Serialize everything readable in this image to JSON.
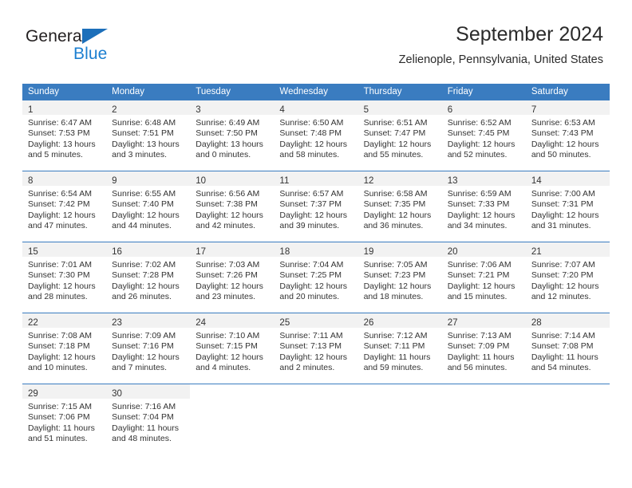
{
  "logo": {
    "primary_text": "General",
    "secondary_text": "Blue",
    "triangle_color": "#1c6fba",
    "primary_color": "#231f20",
    "secondary_color": "#1c7fd0"
  },
  "header": {
    "title": "September 2024",
    "subtitle": "Zelienople, Pennsylvania, United States"
  },
  "theme": {
    "header_bg": "#3a7cc0",
    "header_text": "#ffffff",
    "daynum_bg": "#f2f2f2",
    "body_text": "#333333"
  },
  "calendar": {
    "weekday_headers": [
      "Sunday",
      "Monday",
      "Tuesday",
      "Wednesday",
      "Thursday",
      "Friday",
      "Saturday"
    ],
    "weeks": [
      [
        {
          "day": "1",
          "sunrise": "Sunrise: 6:47 AM",
          "sunset": "Sunset: 7:53 PM",
          "daylight_1": "Daylight: 13 hours",
          "daylight_2": "and 5 minutes."
        },
        {
          "day": "2",
          "sunrise": "Sunrise: 6:48 AM",
          "sunset": "Sunset: 7:51 PM",
          "daylight_1": "Daylight: 13 hours",
          "daylight_2": "and 3 minutes."
        },
        {
          "day": "3",
          "sunrise": "Sunrise: 6:49 AM",
          "sunset": "Sunset: 7:50 PM",
          "daylight_1": "Daylight: 13 hours",
          "daylight_2": "and 0 minutes."
        },
        {
          "day": "4",
          "sunrise": "Sunrise: 6:50 AM",
          "sunset": "Sunset: 7:48 PM",
          "daylight_1": "Daylight: 12 hours",
          "daylight_2": "and 58 minutes."
        },
        {
          "day": "5",
          "sunrise": "Sunrise: 6:51 AM",
          "sunset": "Sunset: 7:47 PM",
          "daylight_1": "Daylight: 12 hours",
          "daylight_2": "and 55 minutes."
        },
        {
          "day": "6",
          "sunrise": "Sunrise: 6:52 AM",
          "sunset": "Sunset: 7:45 PM",
          "daylight_1": "Daylight: 12 hours",
          "daylight_2": "and 52 minutes."
        },
        {
          "day": "7",
          "sunrise": "Sunrise: 6:53 AM",
          "sunset": "Sunset: 7:43 PM",
          "daylight_1": "Daylight: 12 hours",
          "daylight_2": "and 50 minutes."
        }
      ],
      [
        {
          "day": "8",
          "sunrise": "Sunrise: 6:54 AM",
          "sunset": "Sunset: 7:42 PM",
          "daylight_1": "Daylight: 12 hours",
          "daylight_2": "and 47 minutes."
        },
        {
          "day": "9",
          "sunrise": "Sunrise: 6:55 AM",
          "sunset": "Sunset: 7:40 PM",
          "daylight_1": "Daylight: 12 hours",
          "daylight_2": "and 44 minutes."
        },
        {
          "day": "10",
          "sunrise": "Sunrise: 6:56 AM",
          "sunset": "Sunset: 7:38 PM",
          "daylight_1": "Daylight: 12 hours",
          "daylight_2": "and 42 minutes."
        },
        {
          "day": "11",
          "sunrise": "Sunrise: 6:57 AM",
          "sunset": "Sunset: 7:37 PM",
          "daylight_1": "Daylight: 12 hours",
          "daylight_2": "and 39 minutes."
        },
        {
          "day": "12",
          "sunrise": "Sunrise: 6:58 AM",
          "sunset": "Sunset: 7:35 PM",
          "daylight_1": "Daylight: 12 hours",
          "daylight_2": "and 36 minutes."
        },
        {
          "day": "13",
          "sunrise": "Sunrise: 6:59 AM",
          "sunset": "Sunset: 7:33 PM",
          "daylight_1": "Daylight: 12 hours",
          "daylight_2": "and 34 minutes."
        },
        {
          "day": "14",
          "sunrise": "Sunrise: 7:00 AM",
          "sunset": "Sunset: 7:31 PM",
          "daylight_1": "Daylight: 12 hours",
          "daylight_2": "and 31 minutes."
        }
      ],
      [
        {
          "day": "15",
          "sunrise": "Sunrise: 7:01 AM",
          "sunset": "Sunset: 7:30 PM",
          "daylight_1": "Daylight: 12 hours",
          "daylight_2": "and 28 minutes."
        },
        {
          "day": "16",
          "sunrise": "Sunrise: 7:02 AM",
          "sunset": "Sunset: 7:28 PM",
          "daylight_1": "Daylight: 12 hours",
          "daylight_2": "and 26 minutes."
        },
        {
          "day": "17",
          "sunrise": "Sunrise: 7:03 AM",
          "sunset": "Sunset: 7:26 PM",
          "daylight_1": "Daylight: 12 hours",
          "daylight_2": "and 23 minutes."
        },
        {
          "day": "18",
          "sunrise": "Sunrise: 7:04 AM",
          "sunset": "Sunset: 7:25 PM",
          "daylight_1": "Daylight: 12 hours",
          "daylight_2": "and 20 minutes."
        },
        {
          "day": "19",
          "sunrise": "Sunrise: 7:05 AM",
          "sunset": "Sunset: 7:23 PM",
          "daylight_1": "Daylight: 12 hours",
          "daylight_2": "and 18 minutes."
        },
        {
          "day": "20",
          "sunrise": "Sunrise: 7:06 AM",
          "sunset": "Sunset: 7:21 PM",
          "daylight_1": "Daylight: 12 hours",
          "daylight_2": "and 15 minutes."
        },
        {
          "day": "21",
          "sunrise": "Sunrise: 7:07 AM",
          "sunset": "Sunset: 7:20 PM",
          "daylight_1": "Daylight: 12 hours",
          "daylight_2": "and 12 minutes."
        }
      ],
      [
        {
          "day": "22",
          "sunrise": "Sunrise: 7:08 AM",
          "sunset": "Sunset: 7:18 PM",
          "daylight_1": "Daylight: 12 hours",
          "daylight_2": "and 10 minutes."
        },
        {
          "day": "23",
          "sunrise": "Sunrise: 7:09 AM",
          "sunset": "Sunset: 7:16 PM",
          "daylight_1": "Daylight: 12 hours",
          "daylight_2": "and 7 minutes."
        },
        {
          "day": "24",
          "sunrise": "Sunrise: 7:10 AM",
          "sunset": "Sunset: 7:15 PM",
          "daylight_1": "Daylight: 12 hours",
          "daylight_2": "and 4 minutes."
        },
        {
          "day": "25",
          "sunrise": "Sunrise: 7:11 AM",
          "sunset": "Sunset: 7:13 PM",
          "daylight_1": "Daylight: 12 hours",
          "daylight_2": "and 2 minutes."
        },
        {
          "day": "26",
          "sunrise": "Sunrise: 7:12 AM",
          "sunset": "Sunset: 7:11 PM",
          "daylight_1": "Daylight: 11 hours",
          "daylight_2": "and 59 minutes."
        },
        {
          "day": "27",
          "sunrise": "Sunrise: 7:13 AM",
          "sunset": "Sunset: 7:09 PM",
          "daylight_1": "Daylight: 11 hours",
          "daylight_2": "and 56 minutes."
        },
        {
          "day": "28",
          "sunrise": "Sunrise: 7:14 AM",
          "sunset": "Sunset: 7:08 PM",
          "daylight_1": "Daylight: 11 hours",
          "daylight_2": "and 54 minutes."
        }
      ],
      [
        {
          "day": "29",
          "sunrise": "Sunrise: 7:15 AM",
          "sunset": "Sunset: 7:06 PM",
          "daylight_1": "Daylight: 11 hours",
          "daylight_2": "and 51 minutes."
        },
        {
          "day": "30",
          "sunrise": "Sunrise: 7:16 AM",
          "sunset": "Sunset: 7:04 PM",
          "daylight_1": "Daylight: 11 hours",
          "daylight_2": "and 48 minutes."
        },
        {
          "day": "",
          "sunrise": "",
          "sunset": "",
          "daylight_1": "",
          "daylight_2": ""
        },
        {
          "day": "",
          "sunrise": "",
          "sunset": "",
          "daylight_1": "",
          "daylight_2": ""
        },
        {
          "day": "",
          "sunrise": "",
          "sunset": "",
          "daylight_1": "",
          "daylight_2": ""
        },
        {
          "day": "",
          "sunrise": "",
          "sunset": "",
          "daylight_1": "",
          "daylight_2": ""
        },
        {
          "day": "",
          "sunrise": "",
          "sunset": "",
          "daylight_1": "",
          "daylight_2": ""
        }
      ]
    ]
  }
}
